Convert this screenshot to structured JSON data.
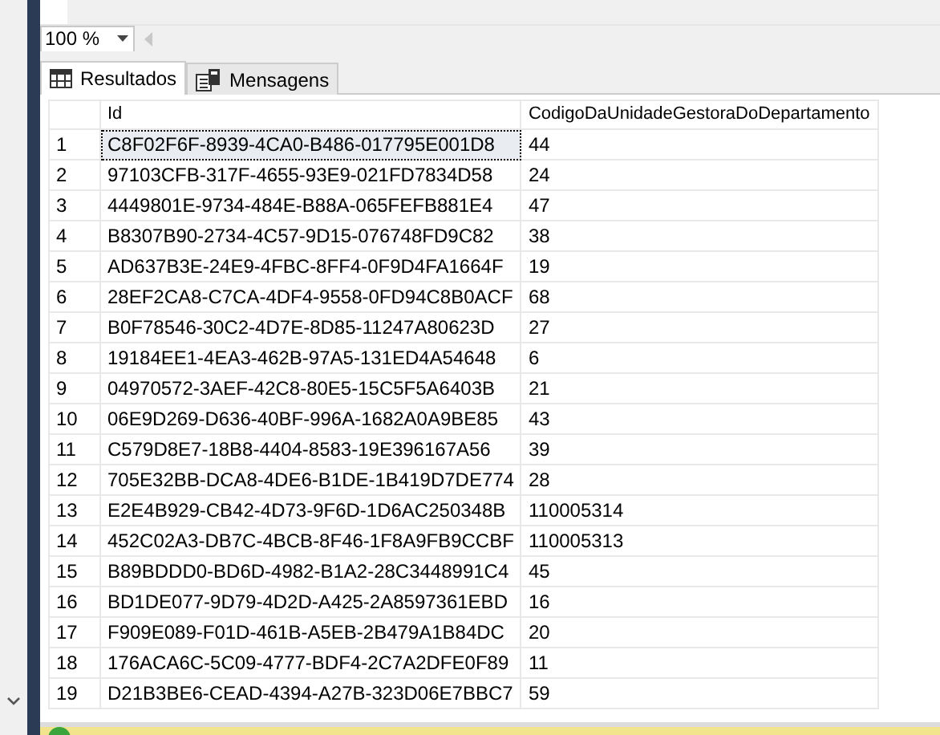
{
  "zoom": {
    "value": "100 %"
  },
  "tabs": [
    {
      "label": "Resultados",
      "kind": "grid",
      "selected": true
    },
    {
      "label": "Mensagens",
      "kind": "messages",
      "selected": false
    }
  ],
  "table": {
    "columns": [
      "Id",
      "CodigoDaUnidadeGestoraDoDepartamento"
    ],
    "rows": [
      {
        "number": "1",
        "id": "C8F02F6F-8939-4CA0-B486-017795E001D8",
        "code": "44",
        "selected": true
      },
      {
        "number": "2",
        "id": "97103CFB-317F-4655-93E9-021FD7834D58",
        "code": "24",
        "selected": false
      },
      {
        "number": "3",
        "id": "4449801E-9734-484E-B88A-065FEFB881E4",
        "code": "47",
        "selected": false
      },
      {
        "number": "4",
        "id": "B8307B90-2734-4C57-9D15-076748FD9C82",
        "code": "38",
        "selected": false
      },
      {
        "number": "5",
        "id": "AD637B3E-24E9-4FBC-8FF4-0F9D4FA1664F",
        "code": "19",
        "selected": false
      },
      {
        "number": "6",
        "id": "28EF2CA8-C7CA-4DF4-9558-0FD94C8B0ACF",
        "code": "68",
        "selected": false
      },
      {
        "number": "7",
        "id": "B0F78546-30C2-4D7E-8D85-11247A80623D",
        "code": "27",
        "selected": false
      },
      {
        "number": "8",
        "id": "19184EE1-4EA3-462B-97A5-131ED4A54648",
        "code": "6",
        "selected": false
      },
      {
        "number": "9",
        "id": "04970572-3AEF-42C8-80E5-15C5F5A6403B",
        "code": "21",
        "selected": false
      },
      {
        "number": "10",
        "id": "06E9D269-D636-40BF-996A-1682A0A9BE85",
        "code": "43",
        "selected": false
      },
      {
        "number": "11",
        "id": "C579D8E7-18B8-4404-8583-19E396167A56",
        "code": "39",
        "selected": false
      },
      {
        "number": "12",
        "id": "705E32BB-DCA8-4DE6-B1DE-1B419D7DE774",
        "code": "28",
        "selected": false
      },
      {
        "number": "13",
        "id": "E2E4B929-CB42-4D73-9F6D-1D6AC250348B",
        "code": "110005314",
        "selected": false
      },
      {
        "number": "14",
        "id": "452C02A3-DB7C-4BCB-8F46-1F8A9FB9CCBF",
        "code": "110005313",
        "selected": false
      },
      {
        "number": "15",
        "id": "B89BDDD0-BD6D-4982-B1A2-28C3448991C4",
        "code": "45",
        "selected": false
      },
      {
        "number": "16",
        "id": "BD1DE077-9D79-4D2D-A425-2A8597361EBD",
        "code": "16",
        "selected": false
      },
      {
        "number": "17",
        "id": "F909E089-F01D-461B-A5EB-2B479A1B84DC",
        "code": "20",
        "selected": false
      },
      {
        "number": "18",
        "id": "176ACA6C-5C09-4777-BDF4-2C7A2DFE0F89",
        "code": "11",
        "selected": false
      },
      {
        "number": "19",
        "id": "D21B3BE6-CEAD-4394-A27B-323D06E7BBC7",
        "code": "59",
        "selected": false
      }
    ]
  }
}
